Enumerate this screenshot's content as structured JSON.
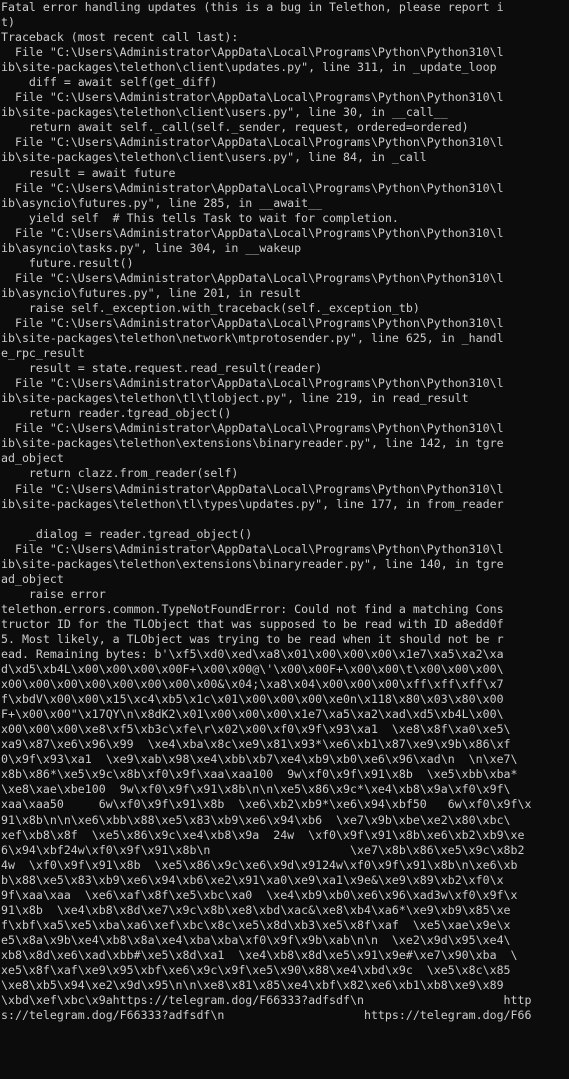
{
  "console": {
    "lines": [
      "Fatal error handling updates (this is a bug in Telethon, please report i",
      "t)",
      "Traceback (most recent call last):",
      "  File \"C:\\Users\\Administrator\\AppData\\Local\\Programs\\Python\\Python310\\l",
      "ib\\site-packages\\telethon\\client\\updates.py\", line 311, in _update_loop",
      "    diff = await self(get_diff)",
      "  File \"C:\\Users\\Administrator\\AppData\\Local\\Programs\\Python\\Python310\\l",
      "ib\\site-packages\\telethon\\client\\users.py\", line 30, in __call__",
      "    return await self._call(self._sender, request, ordered=ordered)",
      "  File \"C:\\Users\\Administrator\\AppData\\Local\\Programs\\Python\\Python310\\l",
      "ib\\site-packages\\telethon\\client\\users.py\", line 84, in _call",
      "    result = await future",
      "  File \"C:\\Users\\Administrator\\AppData\\Local\\Programs\\Python\\Python310\\l",
      "ib\\asyncio\\futures.py\", line 285, in __await__",
      "    yield self  # This tells Task to wait for completion.",
      "  File \"C:\\Users\\Administrator\\AppData\\Local\\Programs\\Python\\Python310\\l",
      "ib\\asyncio\\tasks.py\", line 304, in __wakeup",
      "    future.result()",
      "  File \"C:\\Users\\Administrator\\AppData\\Local\\Programs\\Python\\Python310\\l",
      "ib\\asyncio\\futures.py\", line 201, in result",
      "    raise self._exception.with_traceback(self._exception_tb)",
      "  File \"C:\\Users\\Administrator\\AppData\\Local\\Programs\\Python\\Python310\\l",
      "ib\\site-packages\\telethon\\network\\mtprotosender.py\", line 625, in _handl",
      "e_rpc_result",
      "    result = state.request.read_result(reader)",
      "  File \"C:\\Users\\Administrator\\AppData\\Local\\Programs\\Python\\Python310\\l",
      "ib\\site-packages\\telethon\\tl\\tlobject.py\", line 219, in read_result",
      "    return reader.tgread_object()",
      "  File \"C:\\Users\\Administrator\\AppData\\Local\\Programs\\Python\\Python310\\l",
      "ib\\site-packages\\telethon\\extensions\\binaryreader.py\", line 142, in tgre",
      "ad_object",
      "    return clazz.from_reader(self)",
      "  File \"C:\\Users\\Administrator\\AppData\\Local\\Programs\\Python\\Python310\\l",
      "ib\\site-packages\\telethon\\tl\\types\\updates.py\", line 177, in from_reader",
      "",
      "    _dialog = reader.tgread_object()",
      "  File \"C:\\Users\\Administrator\\AppData\\Local\\Programs\\Python\\Python310\\l",
      "ib\\site-packages\\telethon\\extensions\\binaryreader.py\", line 140, in tgre",
      "ad_object",
      "    raise error",
      "telethon.errors.common.TypeNotFoundError: Could not find a matching Cons",
      "tructor ID for the TLObject that was supposed to be read with ID a8edd0f",
      "5. Most likely, a TLObject was trying to be read when it should not be r",
      "ead. Remaining bytes: b'\\xf5\\xd0\\xed\\xa8\\x01\\x00\\x00\\x00\\x1e7\\xa5\\xa2\\xa",
      "d\\xd5\\xb4L\\x00\\x00\\x00\\x00F+\\x00\\x00@\\'\\x00\\x00F+\\x00\\x00\\t\\x00\\x00\\x00\\",
      "x00\\x00\\x00\\x00\\x00\\x00\\x00\\x00&\\x04;\\xa8\\x04\\x00\\x00\\x00\\xff\\xff\\xff\\x7",
      "f\\xbdV\\x00\\x00\\x15\\xc4\\xb5\\x1c\\x01\\x00\\x00\\x00\\xe0n\\x118\\x80\\x03\\x80\\x00",
      "F+\\x00\\x00\"\\x17QY\\n\\x8dK2\\x01\\x00\\x00\\x00\\x1e7\\xa5\\xa2\\xad\\xd5\\xb4L\\x00\\",
      "x00\\x00\\x00\\xe8\\xf5\\xb3c\\xfe\\r\\x02\\x00\\xf0\\x9f\\x93\\xa1  \\xe8\\x8f\\xa0\\xe5\\",
      "xa9\\x87\\xe6\\x96\\x99  \\xe4\\xba\\x8c\\xe9\\x81\\x93*\\xe6\\xb1\\x87\\xe9\\x9b\\x86\\xf",
      "0\\x9f\\x93\\xa1  \\xe9\\xab\\x98\\xe4\\xbb\\xb7\\xe4\\xb9\\xb0\\xe6\\x96\\xad\\n  \\n\\xe7\\",
      "x8b\\x86*\\xe5\\x9c\\x8b\\xf0\\x9f\\xaa\\xaa100  9w\\xf0\\x9f\\x91\\x8b  \\xe5\\xbb\\xba*",
      "\\xe8\\xae\\xbe100  9w\\xf0\\x9f\\x91\\x8b\\n\\n\\xe5\\x86\\x9c*\\xe4\\xb8\\x9a\\xf0\\x9f\\",
      "xaa\\xaa50     6w\\xf0\\x9f\\x91\\x8b  \\xe6\\xb2\\xb9*\\xe6\\x94\\xbf50   6w\\xf0\\x9f\\x",
      "91\\x8b\\n\\n\\xe6\\xbb\\x88\\xe5\\x83\\xb9\\xe6\\x94\\xb6  \\xe7\\x9b\\xbe\\xe2\\x80\\xbc\\",
      "xef\\xb8\\x8f  \\xe5\\x86\\x9c\\xe4\\xb8\\x9a  24w  \\xf0\\x9f\\x91\\x8b\\xe6\\xb2\\xb9\\xe",
      "6\\x94\\xbf24w\\xf0\\x9f\\x91\\x8b\\n                    \\xe7\\x8b\\x86\\xe5\\x9c\\x8b2",
      "4w  \\xf0\\x9f\\x91\\x8b  \\xe5\\x86\\x9c\\xe6\\x9d\\x9124w\\xf0\\x9f\\x91\\x8b\\n\\xe6\\xb",
      "b\\x88\\xe5\\x83\\xb9\\xe6\\x94\\xb6\\xe2\\x91\\xa0\\xe9\\xa1\\x9e&\\xe9\\x89\\xb2\\xf0\\x",
      "9f\\xaa\\xaa  \\xe6\\xaf\\x8f\\xe5\\xbc\\xa0  \\xe4\\xb9\\xb0\\xe6\\x96\\xad3w\\xf0\\x9f\\x",
      "91\\x8b  \\xe4\\xb8\\x8d\\xe7\\x9c\\x8b\\xe8\\xbd\\xac&\\xe8\\xb4\\xa6*\\xe9\\xb9\\x85\\xe",
      "f\\xbf\\xa5\\xe5\\xba\\xa6\\xef\\xbc\\x8c\\xe5\\x8d\\xb3\\xe5\\x8f\\xaf  \\xe5\\xae\\x9e\\x",
      "e5\\x8a\\x9b\\xe4\\xb8\\x8a\\xe4\\xba\\xba\\xf0\\x9f\\x9b\\xab\\n\\n  \\xe2\\x9d\\x95\\xe4\\",
      "xb8\\x8d\\xe6\\xad\\xbb#\\xe5\\x8d\\xa1  \\xe4\\xb8\\x8d\\xe5\\x91\\x9e#\\xe7\\x90\\xba  \\",
      "xe5\\x8f\\xaf\\xe9\\x95\\xbf\\xe6\\x9c\\x9f\\xe5\\x90\\x88\\xe4\\xbd\\x9c  \\xe5\\x8c\\x85",
      "\\xe8\\xb5\\x94\\xe2\\x9d\\x95\\n\\n\\xe8\\x81\\x85\\xe4\\xbf\\x82\\xe6\\xb1\\xb8\\xe9\\x89",
      "\\xbd\\xef\\xbc\\x9ahttps://telegram.dog/F66333?adfsdf\\n                    http",
      "s://telegram.dog/F66333?adfsdf\\n                    https://telegram.dog/F66"
    ]
  }
}
